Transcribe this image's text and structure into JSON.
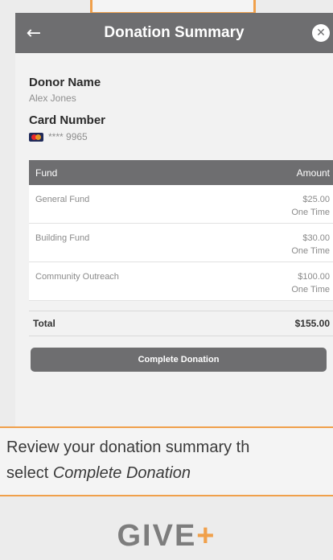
{
  "header": {
    "back_icon": "←",
    "title": "Donation Summary",
    "close_icon": "✕"
  },
  "donor": {
    "name_label": "Donor Name",
    "name_value": "Alex Jones",
    "card_label": "Card Number",
    "card_icon": "mastercard-icon",
    "card_value": "**** 9965"
  },
  "table": {
    "headers": [
      "Fund",
      "Amount"
    ],
    "rows": [
      {
        "fund": "General Fund",
        "amount": "$25.00",
        "frequency": "One Time"
      },
      {
        "fund": "Building Fund",
        "amount": "$30.00",
        "frequency": "One Time"
      },
      {
        "fund": "Community Outreach",
        "amount": "$100.00",
        "frequency": "One Time"
      }
    ],
    "total_label": "Total",
    "total_value": "$155.00"
  },
  "complete_button": "Complete Donation",
  "caption": {
    "line1": "Review your donation summary th",
    "line2_prefix": "select ",
    "line2_emphasis": "Complete Donation"
  },
  "logo": {
    "text": "GIVE",
    "plus": "+"
  },
  "colors": {
    "header": "#6e6e70",
    "accent": "#f0a04b"
  }
}
